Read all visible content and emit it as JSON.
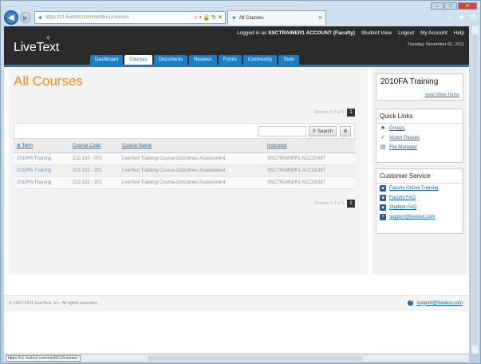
{
  "browser": {
    "address_url": "https://c1.livetext.com/mod5/c1/courses",
    "tab_title": "All Courses",
    "status_url": "https://c1.livetext.com/mod5/c1/courses"
  },
  "header": {
    "logo": "LiveText",
    "logged_in_text": "Logged in as",
    "account_name": "SSCTRAINER1 ACCOUNT (Faculty)",
    "links": [
      "Student View",
      "Logout",
      "My Account",
      "Help"
    ],
    "date": "Tuesday, November 01, 2011"
  },
  "menu": [
    "Dashboard",
    "Courses",
    "Documents",
    "Reviews",
    "Forms",
    "Community",
    "Tools"
  ],
  "active_menu": "Courses",
  "main": {
    "title": "All Courses",
    "pager_text": "Showing 1-3 of 3",
    "page_number": "1",
    "search_label": "Search",
    "columns": [
      "Term",
      "Course Code",
      "Course Name",
      "Instructor"
    ],
    "rows": [
      {
        "term": "2010FA Training",
        "code": "222.102 - 001",
        "name": "LiveText Training Course-Outcomes Assessment",
        "instructor": "SSCTRAINER1 ACCOUNT"
      },
      {
        "term": "2010FA Training",
        "code": "222.102 - 201",
        "name": "LiveText Training Course-Outcomes Assessment",
        "instructor": "SSCTRAINER1 ACCOUNT"
      },
      {
        "term": "2010FA Training",
        "code": "222.102 - 202",
        "name": "LiveText Training Course-Outcomes Assessment",
        "instructor": "SSCTRAINER1 ACCOUNT"
      }
    ]
  },
  "sidebar": {
    "term": "2010FA Training",
    "view_other_terms": "View Other Terms",
    "quick_links_title": "Quick Links",
    "quick_links": [
      {
        "label": "Groups",
        "icon": "groups-icon"
      },
      {
        "label": "Visitor Passes",
        "icon": "pass-icon"
      },
      {
        "label": "File Manager",
        "icon": "file-icon"
      }
    ],
    "service_title": "Customer Service",
    "service_links": [
      {
        "label": "Faculty Online Training",
        "icon": "training-icon"
      },
      {
        "label": "Faculty FAQ",
        "icon": "faq-icon"
      },
      {
        "label": "Student FAQ",
        "icon": "faq-icon"
      },
      {
        "label": "support@livetext.com",
        "icon": "support-icon"
      }
    ]
  },
  "footer": {
    "copyright": "© 1997-2011 LiveText, Inc. All rights reserved.",
    "support": "support@livetext.com"
  },
  "colors": {
    "accent": "#1b7ec4",
    "title_orange": "#f28e1c",
    "header_dark": "#2a2a2a"
  }
}
